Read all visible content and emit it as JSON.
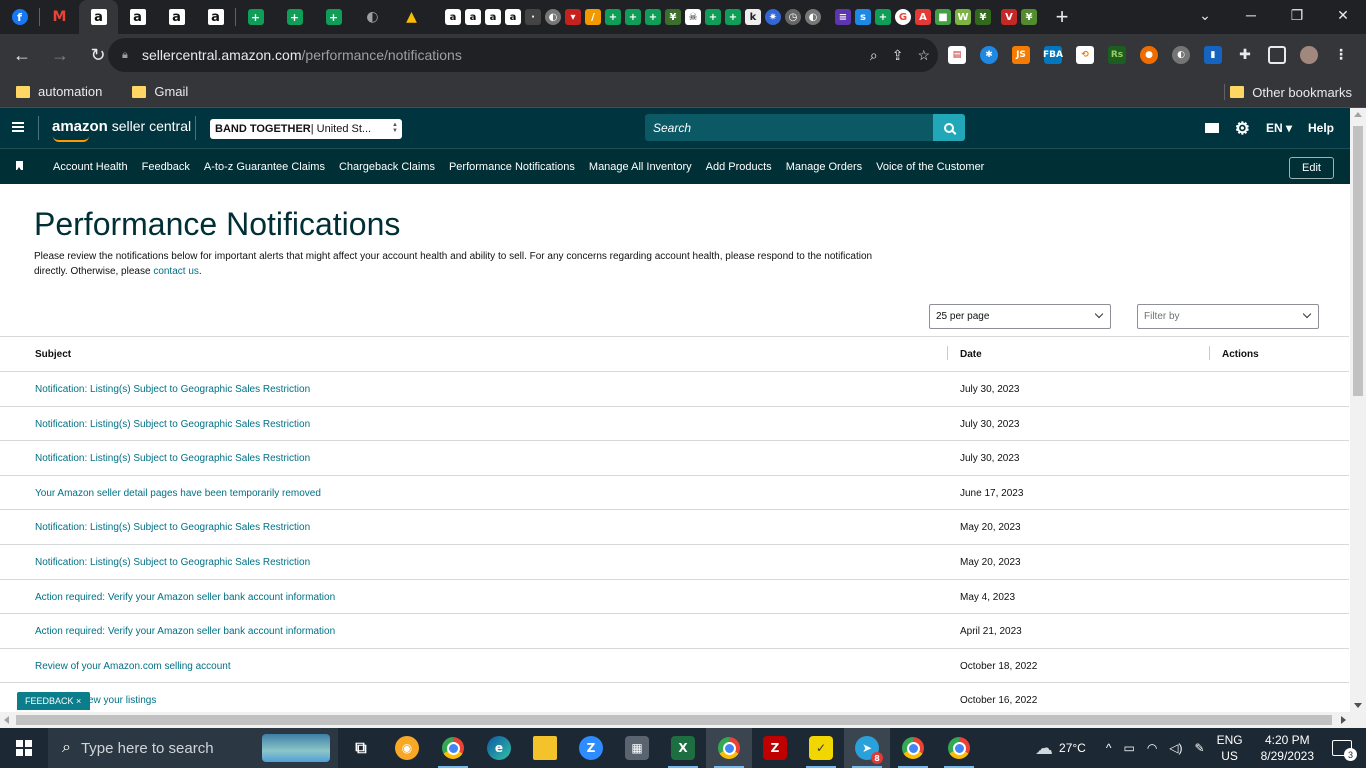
{
  "browser": {
    "url_host": "sellercentral.amazon.com",
    "url_path": "/performance/notifications",
    "new_tab_label": "+",
    "bookmarks": [
      "automation",
      "Gmail"
    ],
    "other_bookmarks": "Other bookmarks"
  },
  "header": {
    "logo_brand": "amazon",
    "logo_suffix": " seller central",
    "marketplace_store": "BAND TOGETHER",
    "marketplace_region": " | United St...",
    "search_placeholder": "Search",
    "language": "EN",
    "help": "Help"
  },
  "nav": {
    "links": [
      "Account Health",
      "Feedback",
      "A-to-z Guarantee Claims",
      "Chargeback Claims",
      "Performance Notifications",
      "Manage All Inventory",
      "Add Products",
      "Manage Orders",
      "Voice of the Customer"
    ],
    "edit": "Edit"
  },
  "page": {
    "title": "Performance Notifications",
    "intro": "Please review the notifications below for important alerts that might affect your account health and ability to sell. For any concerns regarding account health, please respond to the notification directly. Otherwise, please ",
    "contact_link": "contact us",
    "intro_end": ".",
    "per_page": "25 per page",
    "filter_placeholder": "Filter by"
  },
  "table": {
    "headers": {
      "subject": "Subject",
      "date": "Date",
      "actions": "Actions"
    },
    "rows": [
      {
        "subject": "Notification: Listing(s) Subject to Geographic Sales Restriction",
        "date": "July 30, 2023"
      },
      {
        "subject": "Notification: Listing(s) Subject to Geographic Sales Restriction",
        "date": "July 30, 2023"
      },
      {
        "subject": "Notification: Listing(s) Subject to Geographic Sales Restriction",
        "date": "July 30, 2023"
      },
      {
        "subject": "Your Amazon seller detail pages have been temporarily removed",
        "date": "June 17, 2023"
      },
      {
        "subject": "Notification: Listing(s) Subject to Geographic Sales Restriction",
        "date": "May 20, 2023"
      },
      {
        "subject": "Notification: Listing(s) Subject to Geographic Sales Restriction",
        "date": "May 20, 2023"
      },
      {
        "subject": "Action required: Verify your Amazon seller bank account information",
        "date": "May 4, 2023"
      },
      {
        "subject": "Action required: Verify your Amazon seller bank account information",
        "date": "April 21, 2023"
      },
      {
        "subject": "Review of your Amazon.com selling account",
        "date": "October 18, 2022"
      },
      {
        "subject": "ew your listings",
        "date": "October 16, 2022"
      }
    ]
  },
  "feedback_tab": "FEEDBACK",
  "feedback_close": "×",
  "taskbar": {
    "search_placeholder": "Type here to search",
    "weather": "27°C",
    "language_line1": "ENG",
    "language_line2": "US",
    "time": "4:20 PM",
    "date": "8/29/2023",
    "notification_count": "3",
    "telegram_badge": "8"
  },
  "colors": {
    "header_bg": "#00343f",
    "nav_bg": "#002f36",
    "link": "#007185",
    "accent_search": "#21a7b8",
    "feedback_bg": "#0c7d8b"
  }
}
